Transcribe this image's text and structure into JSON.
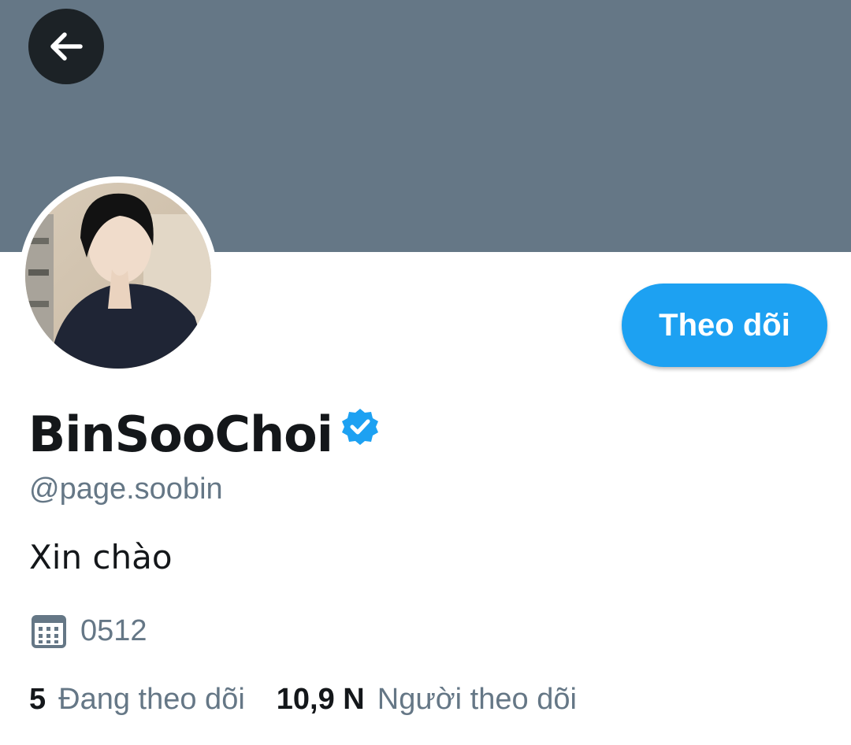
{
  "profile": {
    "display_name": "BinSooChoi",
    "handle": "@page.soobin",
    "bio": "Xin chào",
    "joined": "0512",
    "verified": true
  },
  "actions": {
    "back_icon": "arrow-left-icon",
    "follow_label": "Theo dõi"
  },
  "stats": {
    "following_count": "5",
    "following_label": "Đang theo dõi",
    "followers_count": "10,9 N",
    "followers_label": "Người theo dõi"
  },
  "colors": {
    "banner": "#657786",
    "accent": "#1da1f2",
    "text_primary": "#14171a",
    "text_secondary": "#657786",
    "back_button_bg": "#1c2226"
  }
}
